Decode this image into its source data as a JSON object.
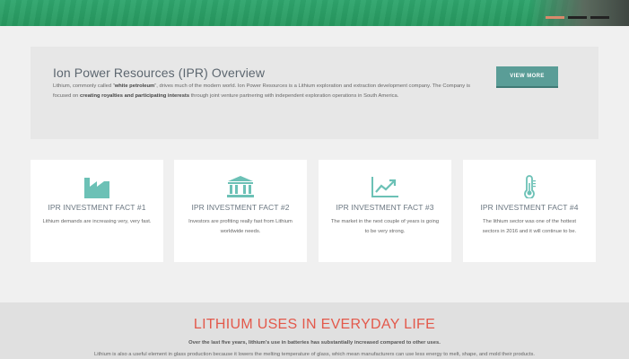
{
  "overview": {
    "title": "Ion Power Resources (IPR) Overview",
    "text_1": "Lithium, commonly called \"",
    "text_bold_1": "white petroleum",
    "text_2": "\", drives much of the modern world. Ion Power Resources is a Lithium exploration and extraction development company. The Company is focused on ",
    "text_bold_2": "creating royalties and participating interests",
    "text_3": " through joint venture partnering with independent exploration operations in South America.",
    "button_label": "VIEW MORE"
  },
  "facts": [
    {
      "icon": "factory-icon",
      "title": "IPR INVESTMENT FACT #1",
      "text": "Lithium demands are increasing very, very fast."
    },
    {
      "icon": "bank-icon",
      "title": "IPR INVESTMENT FACT #2",
      "text": "Investors are profiting really fast from Lithium worldwide needs."
    },
    {
      "icon": "trend-chart-icon",
      "title": "IPR INVESTMENT FACT #3",
      "text": "The market in the next couple of years is going to be very strong."
    },
    {
      "icon": "thermometer-icon",
      "title": "IPR INVESTMENT FACT #4",
      "text": "The lithium sector was one of the hottest sectors in 2016 and it will continue to be."
    }
  ],
  "uses": {
    "title": "LITHIUM USES IN EVERYDAY LIFE",
    "lead": "Over the last five years, lithium's use in batteries has substantially increased compared to other uses.",
    "body": "Lithium is also a useful element in glass production because it lowers the melting temperature of glass, which mean manufacturers can use less energy to melt, shape, and mold their products."
  },
  "colors": {
    "hero_green": "#2fa56d",
    "accent_teal": "#6cc1b6",
    "button": "#5a9d97",
    "heading_red": "#e3594b"
  }
}
